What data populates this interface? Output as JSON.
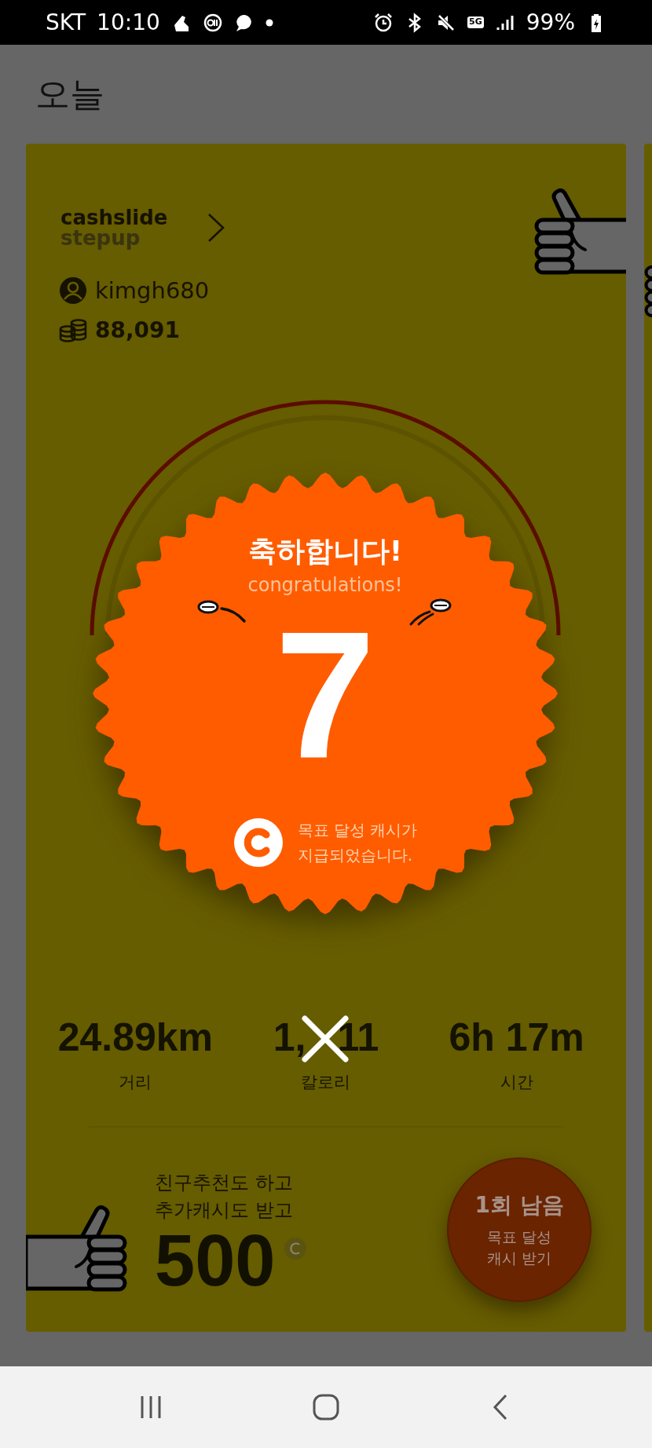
{
  "status_bar": {
    "carrier": "SKT",
    "time": "10:10",
    "network": "5G",
    "battery": "99%"
  },
  "page_title": "오늘",
  "card": {
    "brand": {
      "line_1": "cashslide",
      "line_2": "stepup"
    },
    "user": {
      "name": "kimgh680",
      "coins": "88,091"
    }
  },
  "popup": {
    "title": "축하합니다!",
    "subtitle": "congratulations!",
    "count": "7",
    "message_lines": [
      "목표 달성 캐시가",
      "지급되었습니다."
    ]
  },
  "stats": [
    {
      "value": "24.89km",
      "label": "거리"
    },
    {
      "value_parts": [
        "1,",
        "11"
      ],
      "label": "칼로리"
    },
    {
      "value": "6h 17m",
      "label": "시간"
    }
  ],
  "promo": {
    "lines": [
      "친구추천도 하고",
      "추가캐시도 받고"
    ],
    "amount": "500"
  },
  "goal_button": {
    "title": "1회 남음",
    "lines": [
      "목표 달성",
      "캐시 받기"
    ]
  }
}
